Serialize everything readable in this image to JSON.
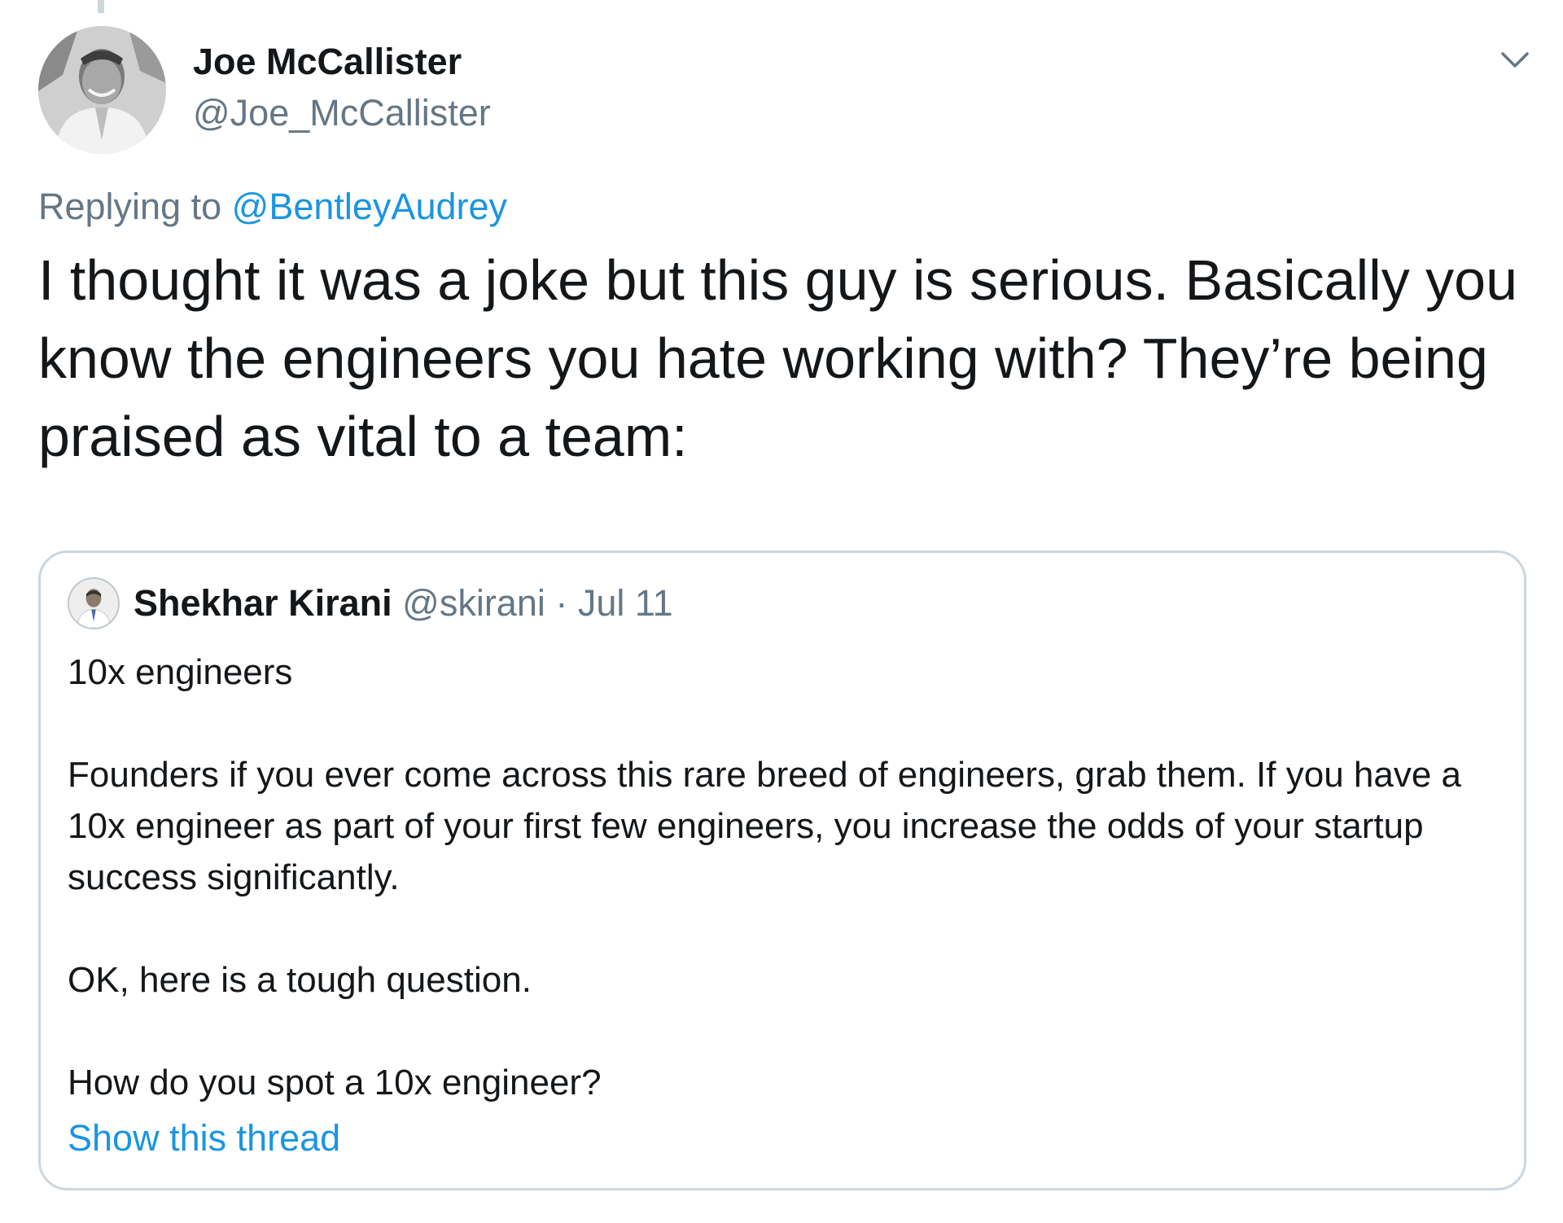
{
  "tweet": {
    "author": {
      "name": "Joe McCallister",
      "handle": "@Joe_McCallister",
      "avatar_icon": "profile-photo"
    },
    "menu_icon": "chevron-down-icon",
    "replying_to": {
      "prefix": "Replying to",
      "handle": "@BentleyAudrey"
    },
    "text": "I thought it was a joke but this guy is serious. Basically you know the engineers you hate working with? They’re being praised as vital to a team:",
    "quoted": {
      "author_name": "Shekhar Kirani",
      "author_handle": "@skirani",
      "separator": "·",
      "date": "Jul 11",
      "paragraphs": [
        "10x engineers",
        "Founders if you ever come across this rare breed of engineers, grab them. If you have a 10x engineer as part of your first few engineers, you increase the odds of your startup success significantly.",
        "OK, here is a tough question.",
        "How do you spot a 10x engineer?"
      ],
      "show_thread_label": "Show this thread"
    }
  },
  "colors": {
    "text_primary": "#14171a",
    "text_secondary": "#657786",
    "link": "#1b95e0",
    "border": "#ccd6dd"
  }
}
